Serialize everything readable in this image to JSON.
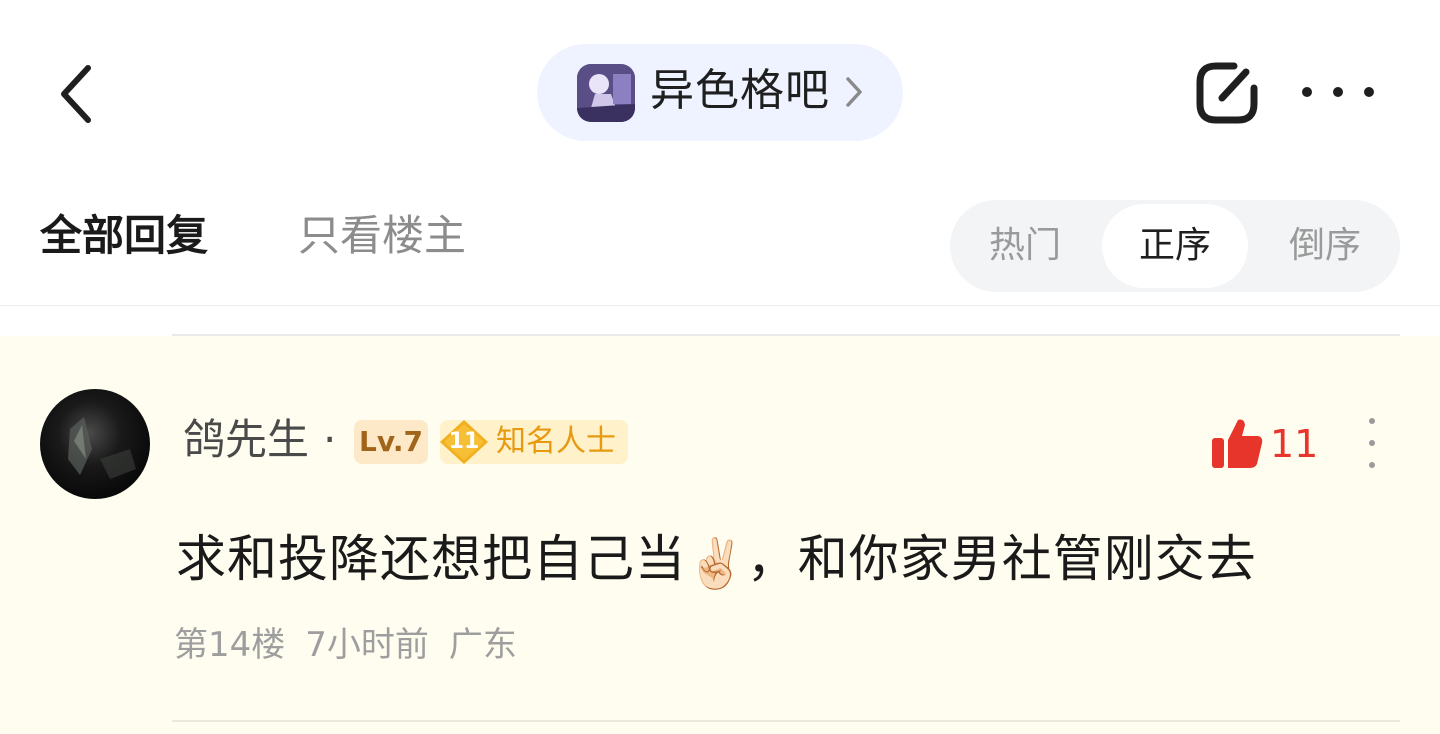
{
  "header": {
    "forum_name": "异色格吧",
    "back_icon": "chevron-left-icon",
    "edit_icon": "edit-icon",
    "more_icon": "more-horizontal-icon"
  },
  "tabs": {
    "all_replies": "全部回复",
    "only_op": "只看楼主"
  },
  "sort": {
    "hot": "热门",
    "ascending": "正序",
    "descending": "倒序",
    "selected": "正序"
  },
  "post": {
    "username": "鸽先生",
    "separator": "·",
    "level": "Lv.7",
    "title_badge_number": "11",
    "title_badge_label": "知名人士",
    "like_count": "11",
    "content_part1": "求和投降还想把自己当",
    "content_emoji": "✌🏻",
    "content_part2": "，和你家男社管刚交去",
    "floor": "第14楼",
    "time": "7小时前",
    "location": "广东"
  },
  "colors": {
    "accent_red": "#e8352c",
    "badge_orange": "#e79a10",
    "post_background": "#fffdf0",
    "pill_background": "#eef3ff"
  }
}
